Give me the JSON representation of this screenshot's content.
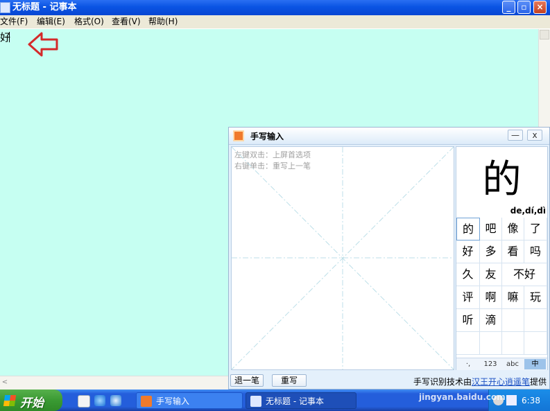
{
  "notepad": {
    "title": "无标题 - 记事本",
    "menu": [
      "文件(F)",
      "编辑(E)",
      "格式(O)",
      "查看(V)",
      "帮助(H)"
    ],
    "content": "好",
    "window_buttons": {
      "minimize": "_",
      "maximize": "▫",
      "close": "×"
    }
  },
  "handwriting": {
    "title": "手写输入",
    "min": "—",
    "close": "x",
    "hints": [
      "左键双击：上屏首选项",
      "右键单击：重写上一笔"
    ],
    "preview_char": "的",
    "pinyin": "de,dí,dì",
    "candidates": [
      [
        "的",
        "吧",
        "像",
        "了"
      ],
      [
        "好",
        "多",
        "看",
        "吗"
      ],
      [
        "久",
        "友",
        "不好"
      ],
      [
        "评",
        "啊",
        "嘛",
        "玩"
      ],
      [
        "听",
        "滴",
        "",
        ""
      ],
      [
        "",
        "",
        "",
        ""
      ]
    ],
    "modes": [
      "·,",
      "123",
      "abc",
      "中"
    ],
    "undo_button": "退一笔",
    "rewrite_button": "重写",
    "credit_prefix": "手写识别技术由",
    "credit_link": "汉王",
    "credit_mid": "",
    "credit_link2": "开心逍遥笔",
    "credit_suffix": "提供"
  },
  "taskbar": {
    "start_label": "开始",
    "tasks": [
      "手写输入",
      "无标题 - 记事本"
    ],
    "clock": "6:38"
  },
  "watermark": "jingyan.baidu.com",
  "colors": {
    "editor_bg": "#c6fff2",
    "arrow": "#d42a2a",
    "title_blue": "#0a54e3"
  }
}
